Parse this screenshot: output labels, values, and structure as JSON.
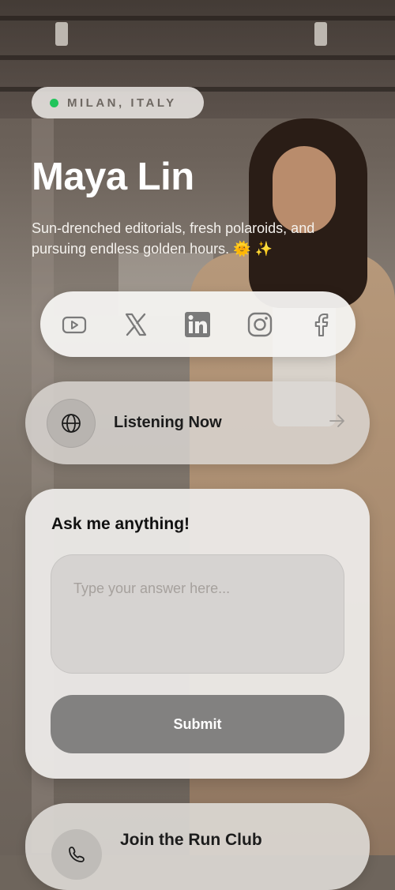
{
  "profile": {
    "location": "MILAN, ITALY",
    "name": "Maya Lin",
    "bio": "Sun-drenched editorials, fresh polaroids, and pursuing endless golden hours. 🌞 ✨"
  },
  "social": [
    {
      "icon": "youtube-icon"
    },
    {
      "icon": "x-icon"
    },
    {
      "icon": "linkedin-icon"
    },
    {
      "icon": "instagram-icon"
    },
    {
      "icon": "facebook-icon"
    }
  ],
  "links": {
    "listening": {
      "label": "Listening Now",
      "icon": "globe-icon"
    },
    "run_club": {
      "label": "Join the Run Club",
      "icon": "phone-icon"
    }
  },
  "ask": {
    "title": "Ask me anything!",
    "placeholder": "Type your answer here...",
    "submit_label": "Submit"
  },
  "colors": {
    "status_dot": "#21c45b",
    "icon_gray": "#7a7a7a",
    "submit_bg": "#828180"
  }
}
